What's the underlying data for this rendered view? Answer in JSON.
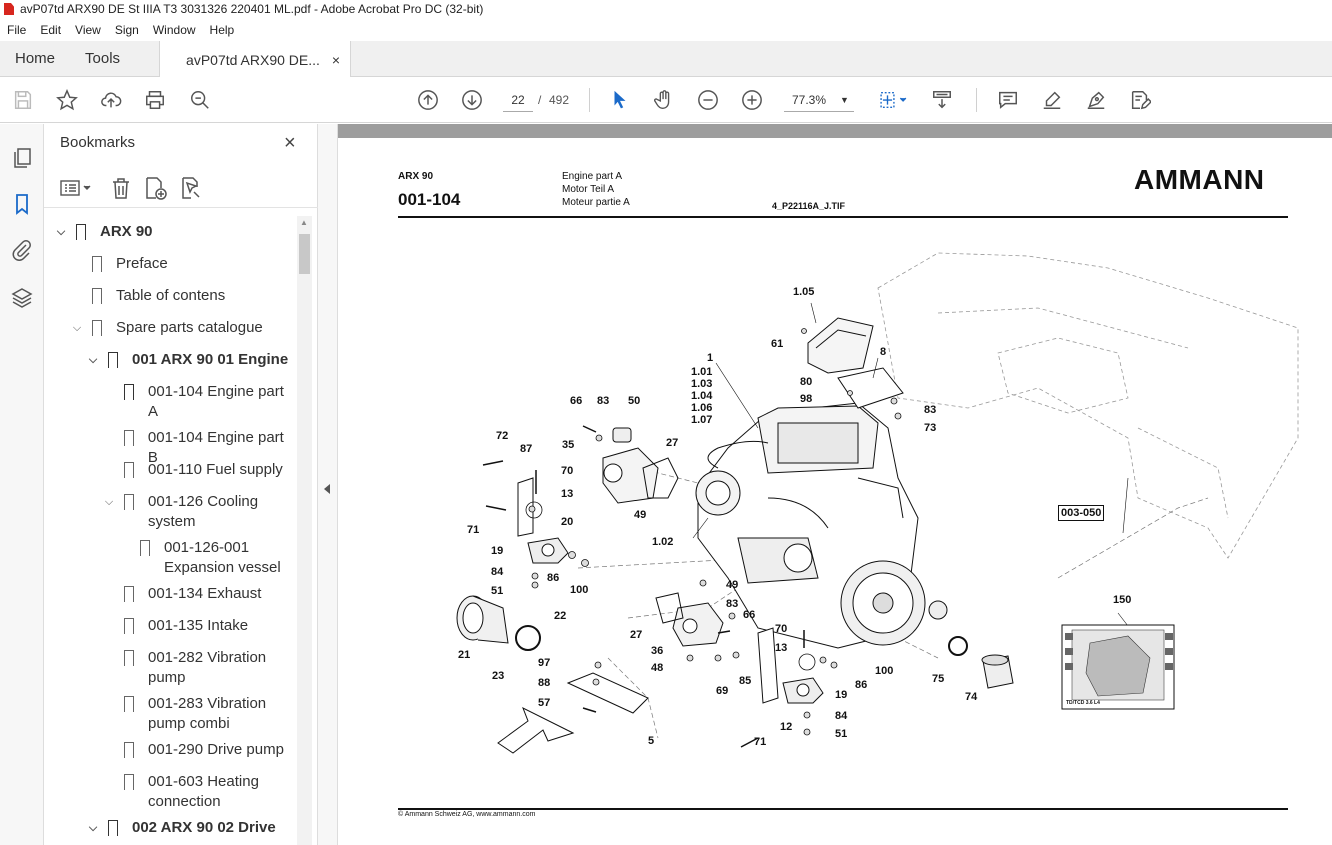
{
  "window": {
    "title": "avP07td ARX90 DE St IIIA T3 3031326 220401 ML.pdf - Adobe Acrobat Pro DC (32-bit)"
  },
  "menu": [
    "File",
    "Edit",
    "View",
    "Sign",
    "Window",
    "Help"
  ],
  "tabs": {
    "home": "Home",
    "tools": "Tools",
    "document": "avP07td ARX90 DE...",
    "close": "×"
  },
  "toolbar": {
    "page_current": "22",
    "page_sep": "/",
    "page_total": "492",
    "zoom": "77.3%"
  },
  "bookmarks": {
    "title": "Bookmarks",
    "close": "×",
    "items": [
      {
        "label": "ARX 90",
        "chev": "⌵"
      },
      {
        "label": "Preface"
      },
      {
        "label": "Table of contens"
      },
      {
        "label": "Spare parts catalogue",
        "chev": "⌵"
      },
      {
        "label": "001 ARX 90 01 Engine",
        "chev": "⌵"
      },
      {
        "label": "001-104 Engine part",
        "label2": "A"
      },
      {
        "label": "001-104 Engine part B"
      },
      {
        "label": "001-110 Fuel supply"
      },
      {
        "label": "001-126 Cooling",
        "label2": "system",
        "chev": "⌵"
      },
      {
        "label": "001-126-001",
        "label2": "Expansion vessel"
      },
      {
        "label": "001-134 Exhaust"
      },
      {
        "label": "001-135 Intake"
      },
      {
        "label": "001-282 Vibration",
        "label2": "pump"
      },
      {
        "label": "001-283 Vibration",
        "label2": "pump combi"
      },
      {
        "label": "001-290 Drive pump"
      },
      {
        "label": "001-603 Heating",
        "label2": "connection"
      },
      {
        "label": "002 ARX 90 02 Drive",
        "chev": "⌵"
      }
    ]
  },
  "document_page": {
    "model": "ARX 90",
    "code": "001-104",
    "desc_en": "Engine part A",
    "desc_de": "Motor Teil A",
    "desc_fr": "Moteur partie A",
    "file_ref": "4_P22116A_J.TIF",
    "brand": "AMMANN",
    "footer": "© Ammann Schweiz AG, www.ammann.com",
    "ref_box": "003-050",
    "callouts": {
      "c1": "1",
      "c101": "1.01",
      "c103": "1.03",
      "c104": "1.04",
      "c106": "1.06",
      "c107": "1.07",
      "c102": "1.02",
      "c105": "1.05",
      "c8": "8",
      "c61": "61",
      "c80": "80",
      "c98": "98",
      "c83a": "83",
      "c73": "73",
      "c66a": "66",
      "c83b": "83",
      "c50": "50",
      "c72": "72",
      "c87": "87",
      "c35": "35",
      "c27a": "27",
      "c70a": "70",
      "c13a": "13",
      "c71a": "71",
      "c20": "20",
      "c49a": "49",
      "c19a": "19",
      "c84a": "84",
      "c51a": "51",
      "c86a": "86",
      "c100a": "100",
      "c22": "22",
      "c21": "21",
      "c23": "23",
      "c97": "97",
      "c88": "88",
      "c57": "57",
      "c5": "5",
      "c49b": "49",
      "c83c": "83",
      "c66b": "66",
      "c27b": "27",
      "c36": "36",
      "c48": "48",
      "c69": "69",
      "c85": "85",
      "c70b": "70",
      "c13b": "13",
      "c86b": "86",
      "c100b": "100",
      "c19b": "19",
      "c84b": "84",
      "c12": "12",
      "c51b": "51",
      "c71b": "71",
      "c75": "75",
      "c74": "74",
      "c150": "150",
      "decal": "TD/TCD 3.6 L4"
    }
  }
}
